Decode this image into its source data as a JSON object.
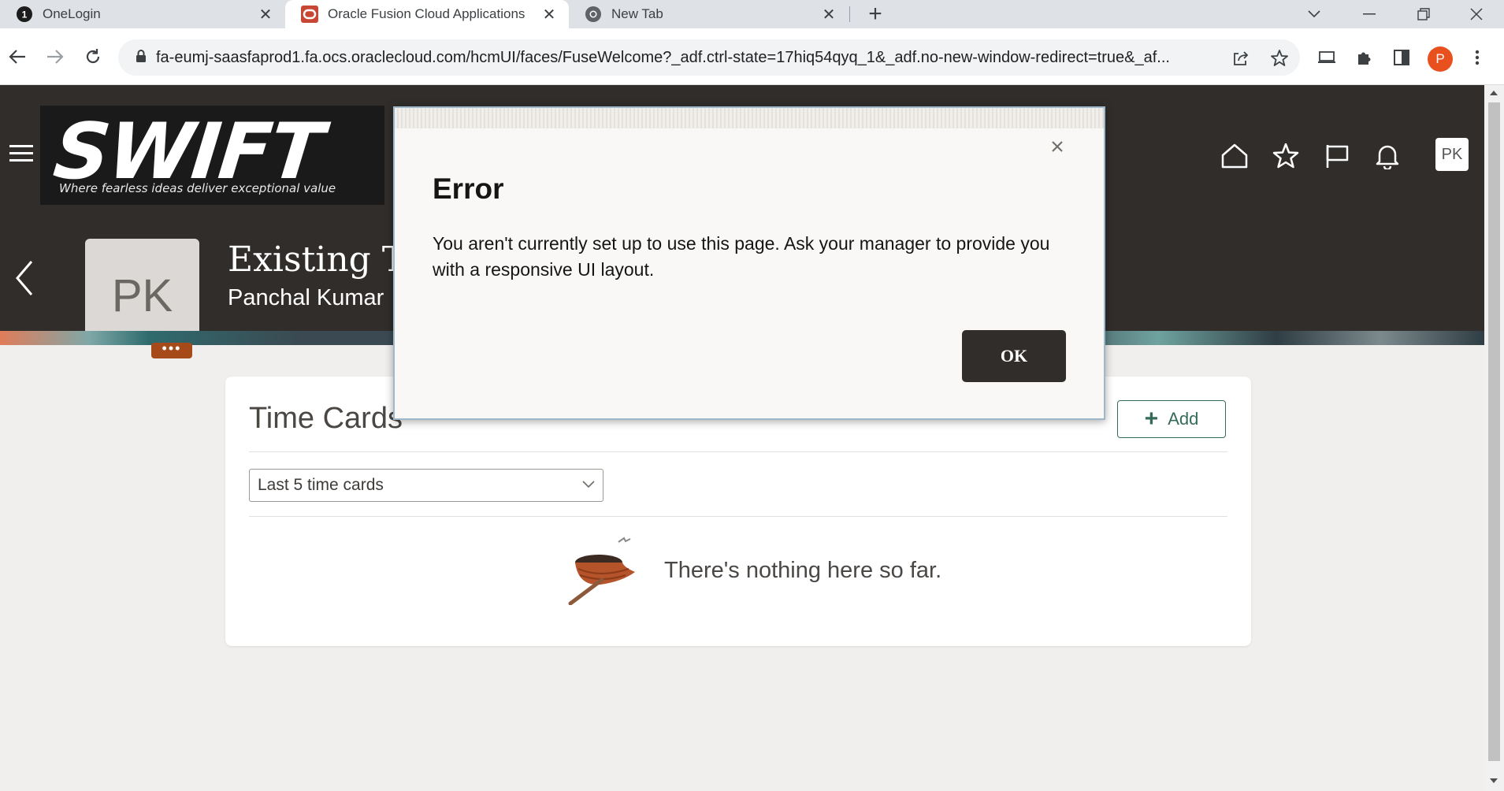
{
  "browser": {
    "tabs": [
      {
        "title": "OneLogin",
        "favicon": "onelogin-icon",
        "active": false
      },
      {
        "title": "Oracle Fusion Cloud Applications",
        "favicon": "oracle-icon",
        "active": true
      },
      {
        "title": "New Tab",
        "favicon": "chrome-icon",
        "active": false
      }
    ],
    "url": "fa-eumj-saasfaprod1.fa.ocs.oraclecloud.com/hcmUI/faces/FuseWelcome?_adf.ctrl-state=17hiq54qyq_1&_adf.no-new-window-redirect=true&_af...",
    "profile_initial": "P",
    "onelogin_badge": "1"
  },
  "header": {
    "logo_text": "SWIFT",
    "logo_tagline": "Where fearless ideas deliver exceptional value",
    "user_initials": "PK",
    "icons": [
      "home-icon",
      "star-icon",
      "flag-icon",
      "bell-icon"
    ]
  },
  "page": {
    "title": "Existing Ti",
    "subtitle": "Panchal Kumar",
    "avatar_initials": "PK",
    "avatar_more": "•••"
  },
  "card": {
    "title": "Time Cards",
    "add_label": "Add",
    "filter_value": "Last 5 time cards",
    "empty_message": "There's nothing here so far."
  },
  "dialog": {
    "title": "Error",
    "message": "You aren't currently set up to use this page. Ask your manager to provide you with a responsive UI layout.",
    "ok_label": "OK"
  },
  "colors": {
    "header_bg": "#312d2a",
    "accent_green": "#356b59",
    "more_badge": "#a74a19",
    "profile": "#e8501e"
  }
}
